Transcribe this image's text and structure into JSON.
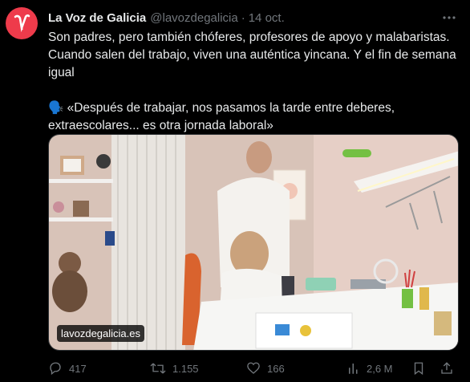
{
  "tweet": {
    "author_name": "La Voz de Galicia",
    "handle": "@lavozdegalicia",
    "separator": "·",
    "date": "14 oct.",
    "text_line1": "Son padres, pero también chóferes, profesores de apoyo y malabaristas. Cuando salen del trabajo, viven una auténtica yincana. Y el fin de semana igual",
    "text_line2": "🗣️ «Después de trabajar, nos pasamos la tarde entre deberes, extraescolares... es otra jornada laboral»",
    "media_source": "lavozdegalicia.es"
  },
  "actions": {
    "replies": "417",
    "retweets": "1.155",
    "likes": "166",
    "views": "2,6 M"
  },
  "colors": {
    "background": "#000000",
    "text": "#e7e9ea",
    "muted": "#71767b",
    "avatar_brand": "#ee3b4b"
  },
  "icons": [
    "more-icon",
    "reply-icon",
    "retweet-icon",
    "like-icon",
    "views-icon",
    "bookmark-icon",
    "share-icon"
  ]
}
